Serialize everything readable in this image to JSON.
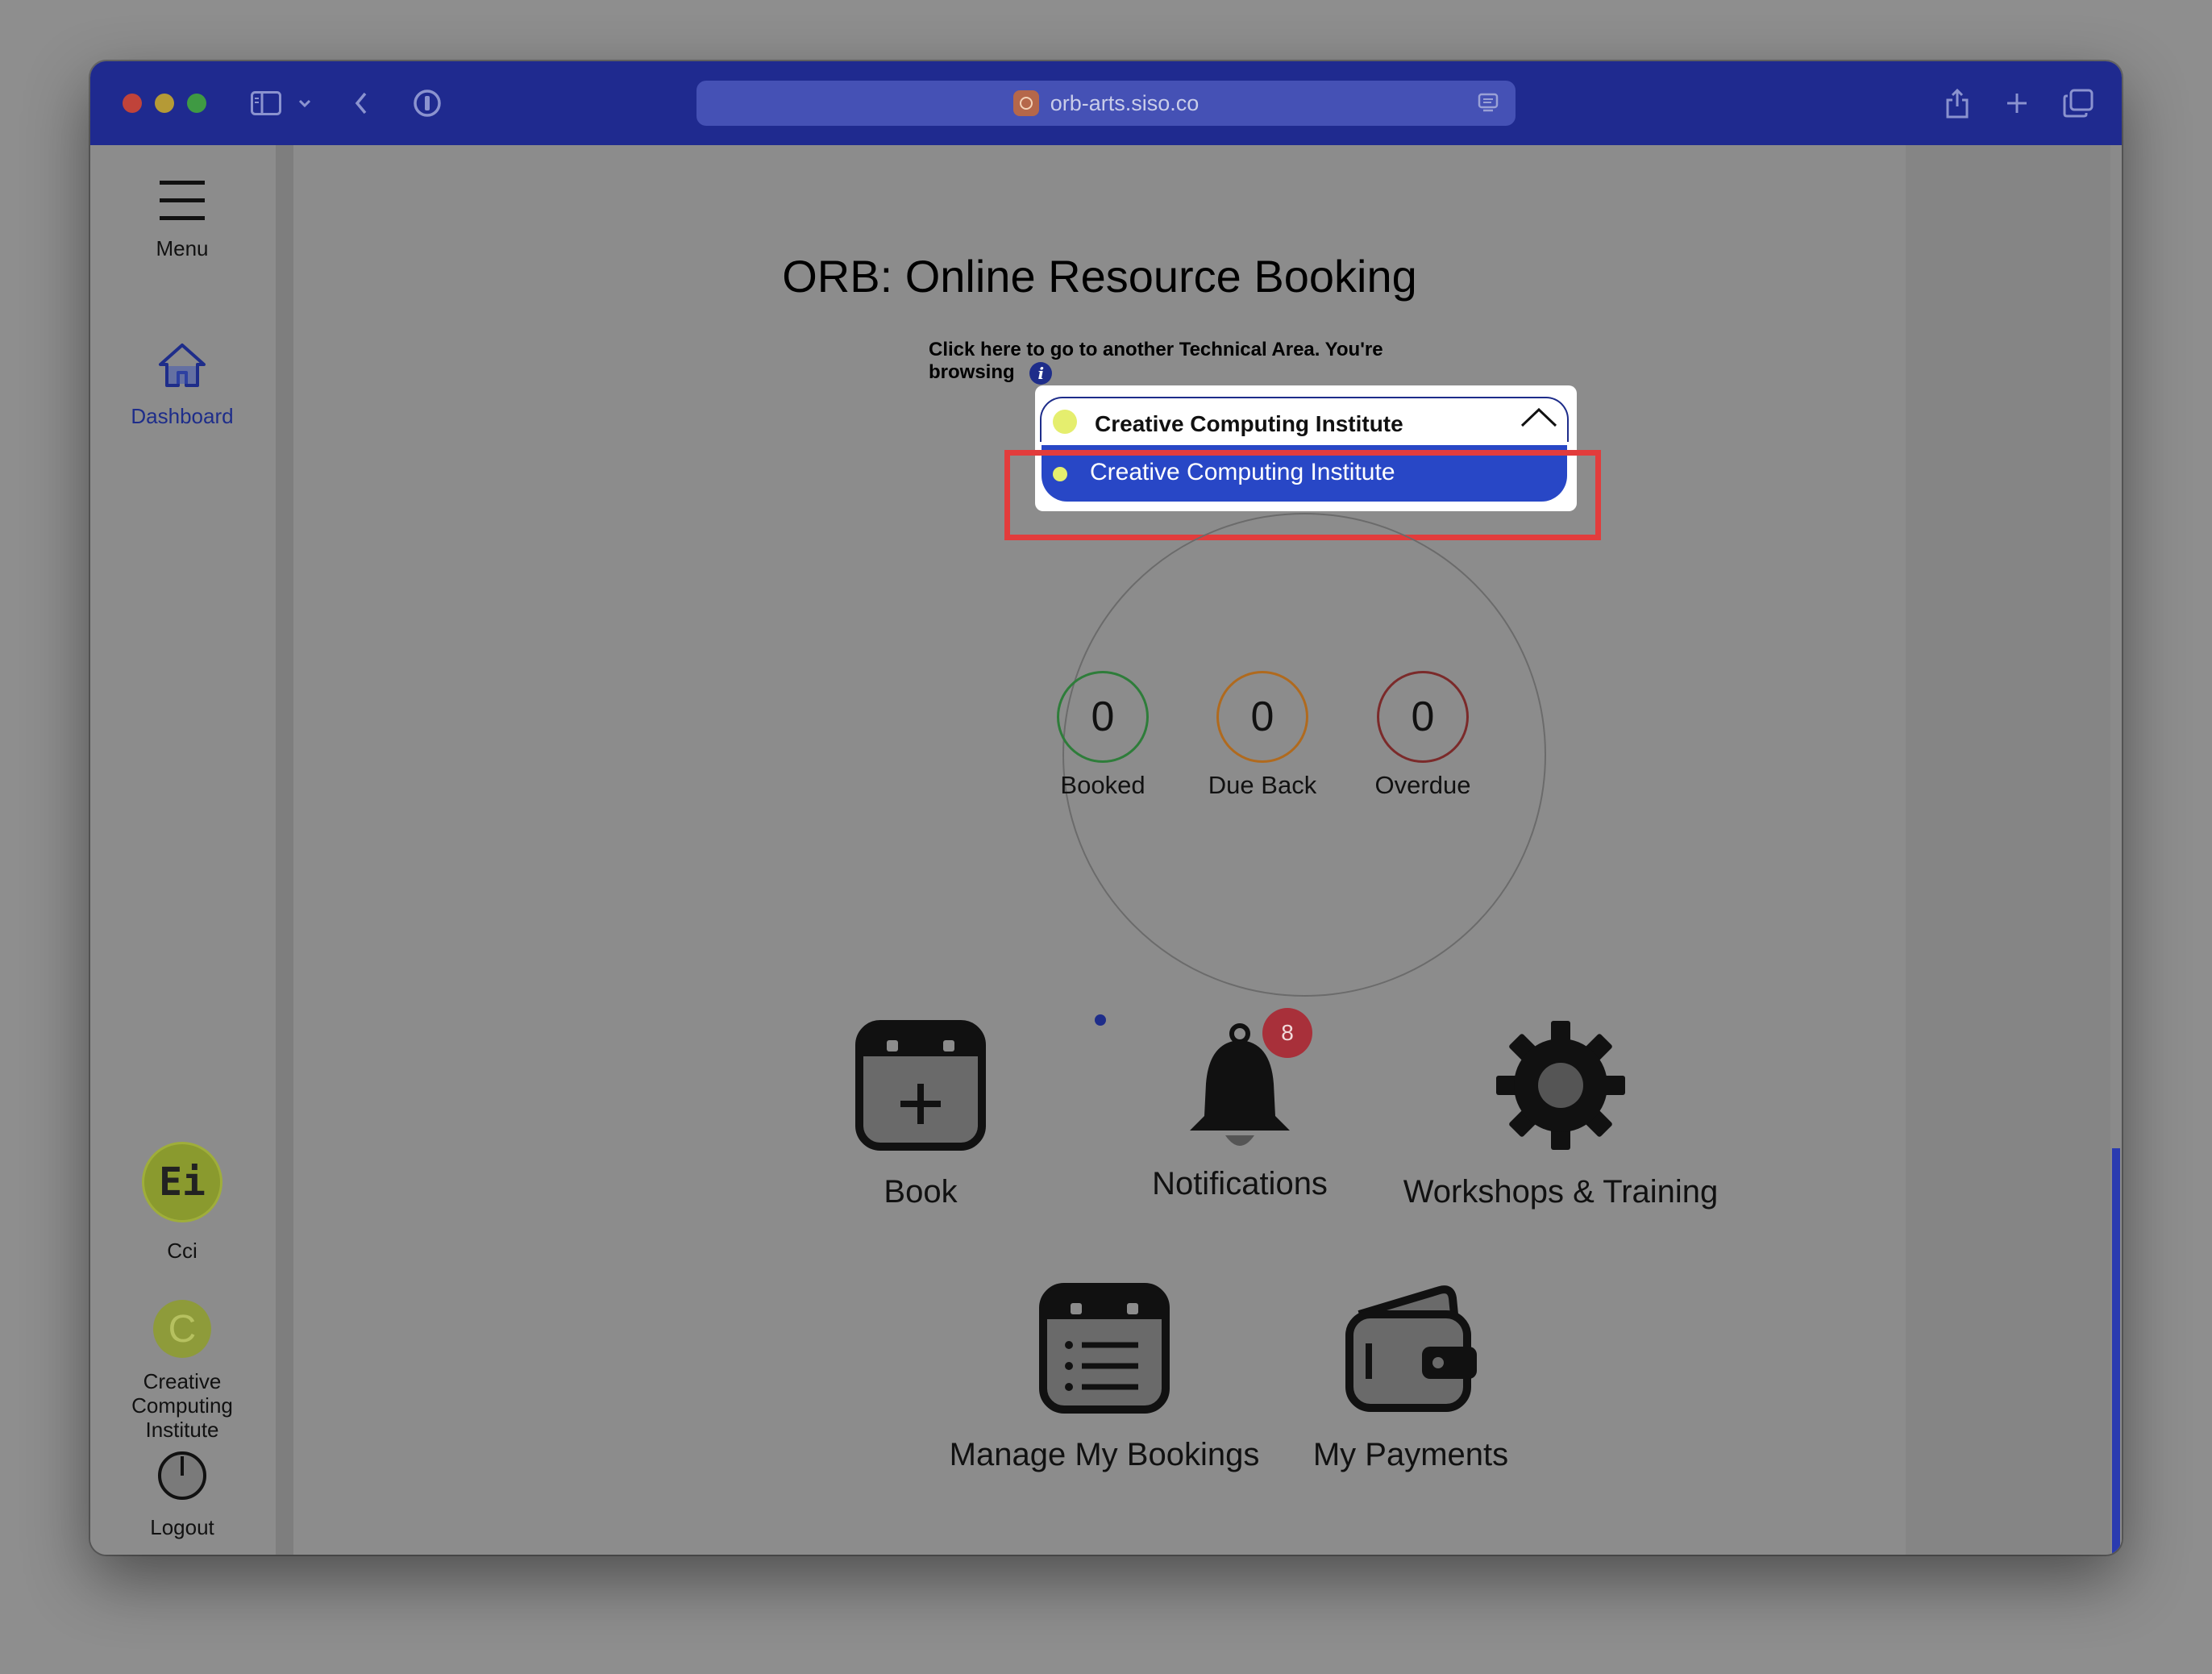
{
  "browser": {
    "url": "orb-arts.siso.co"
  },
  "sidebar": {
    "menu_label": "Menu",
    "dashboard_label": "Dashboard",
    "cci_label": "Cci",
    "cci_logo_text": "Ei",
    "institute_initial": "C",
    "institute_label": "Creative Computing Institute",
    "logout_label": "Logout"
  },
  "main": {
    "title": "ORB: Online Resource Booking",
    "area_hint": "Click here to go to another Technical Area. You're browsing",
    "info_glyph": "i",
    "select": {
      "current_value": "Creative Computing Institute",
      "option": "Creative Computing Institute"
    },
    "stats": [
      {
        "label": "Booked",
        "value": "0",
        "color": "#2e7d3a"
      },
      {
        "label": "Due Back",
        "value": "0",
        "color": "#b06a1e"
      },
      {
        "label": "Overdue",
        "value": "0",
        "color": "#7b2a2a"
      }
    ],
    "tiles": {
      "book": "Book",
      "notifications": "Notifications",
      "notifications_badge": "8",
      "workshops": "Workshops & Training",
      "manage_bookings": "Manage My Bookings",
      "payments": "My Payments"
    }
  },
  "colors": {
    "titlebar": "#1f2a8f",
    "selected_option": "#2847c6",
    "highlight_border": "#e23c3c",
    "status_dot": "#e5ee6e"
  }
}
